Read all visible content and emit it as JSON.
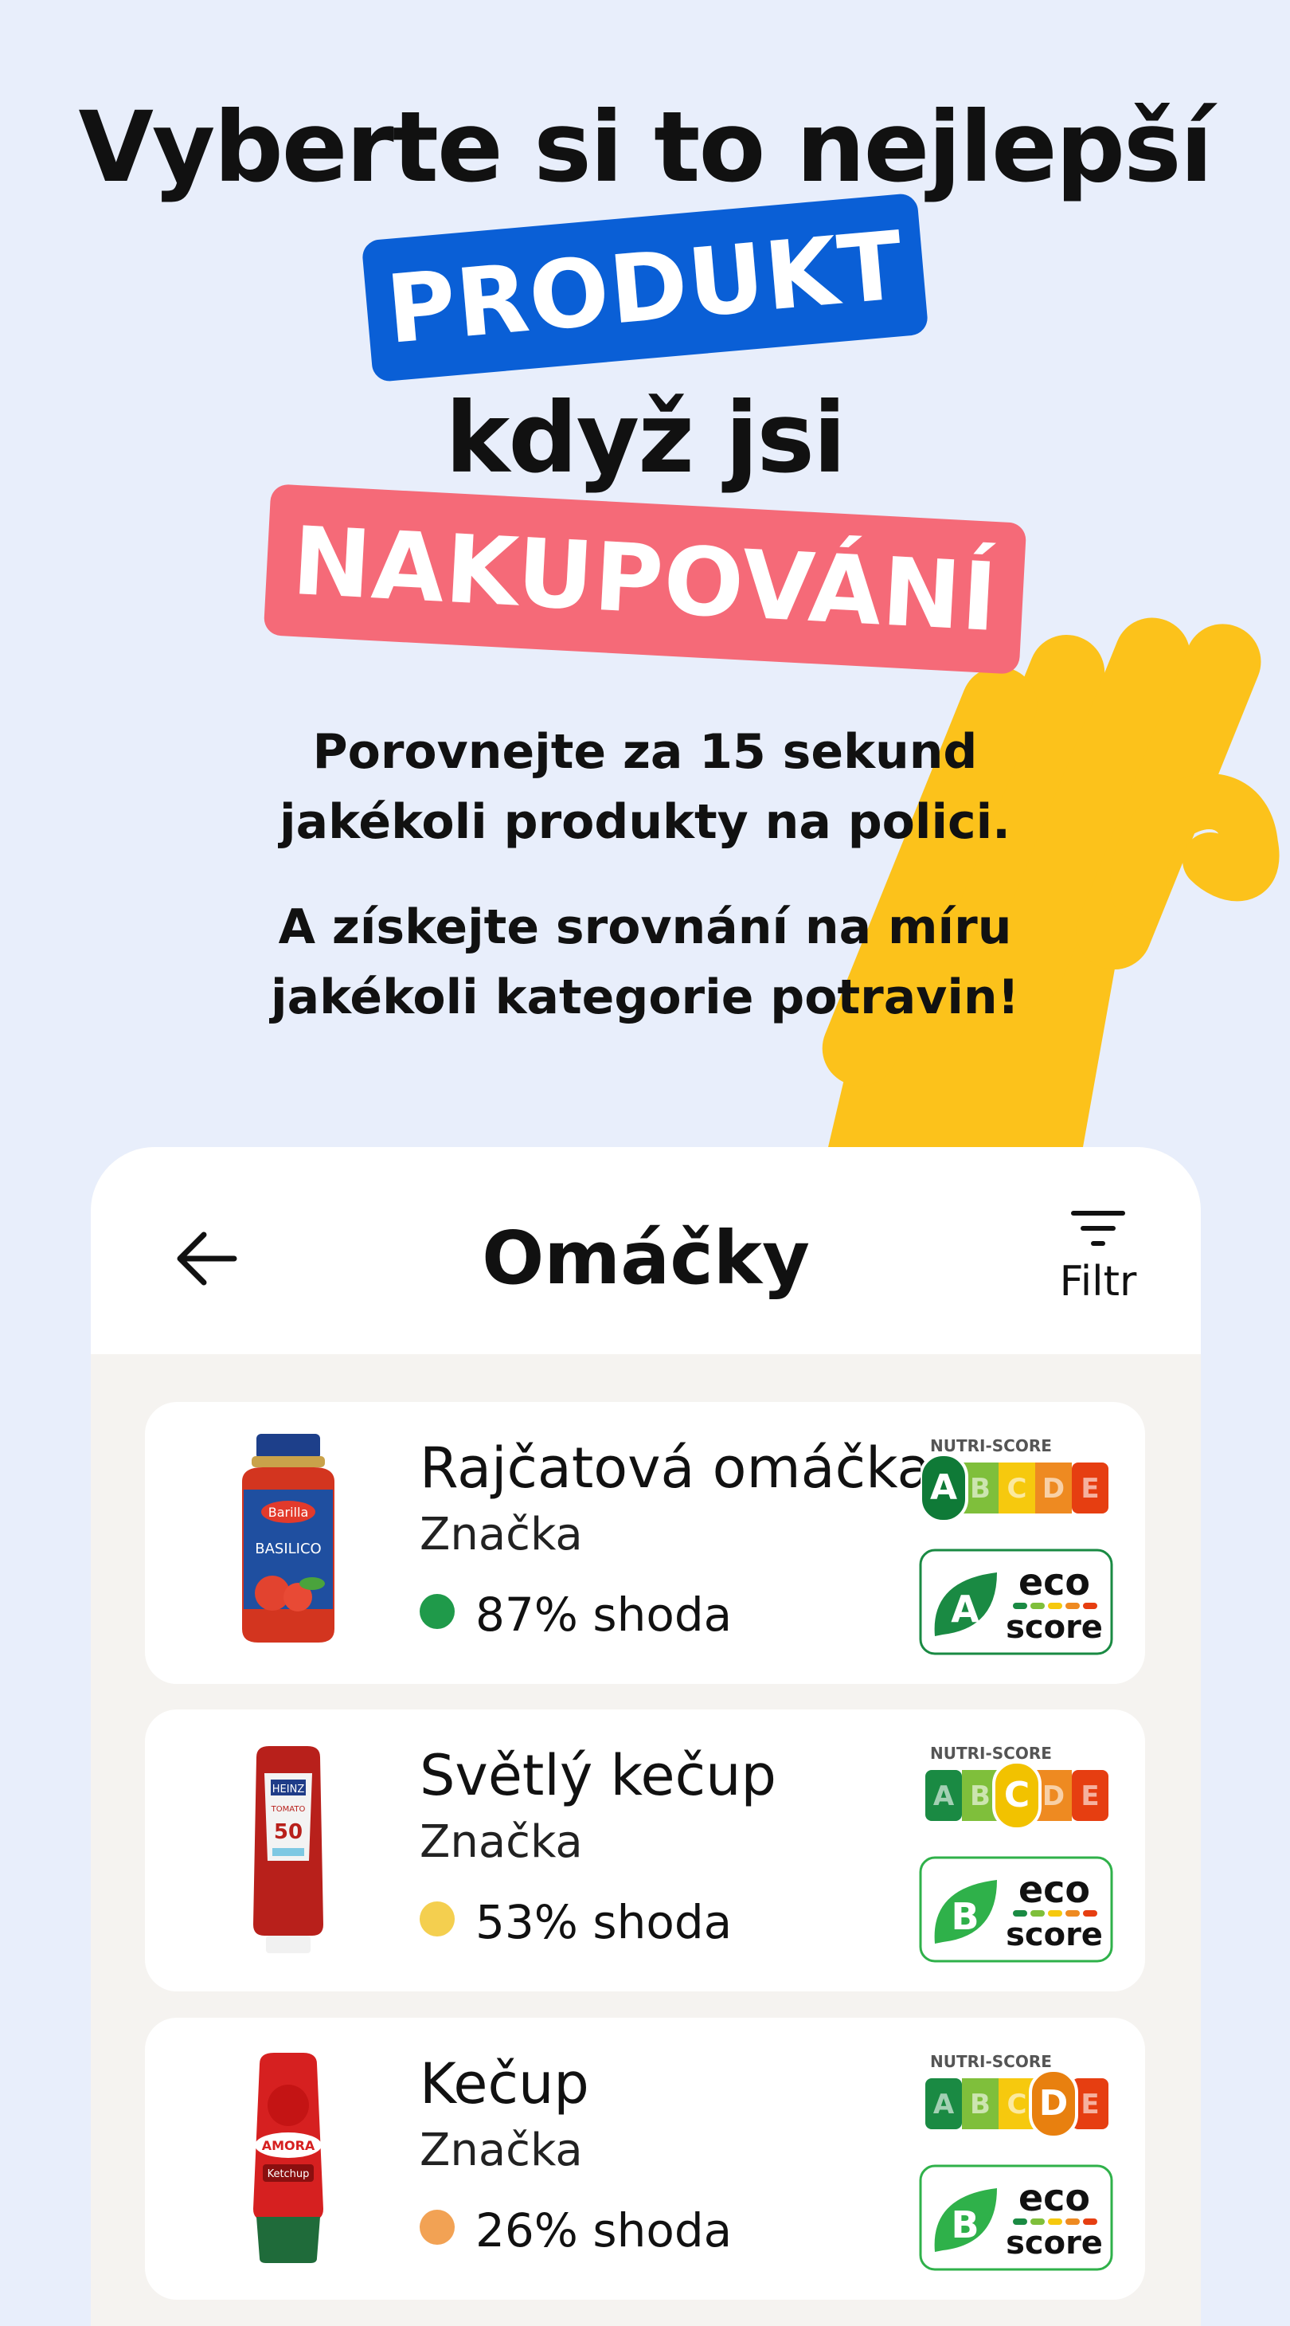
{
  "hero": {
    "line1": "Vyberte si to nejlepší",
    "badge1": "PRODUKT",
    "line3": "když jsi",
    "badge2": "NAKUPOVÁNÍ",
    "sub1_l1": "Porovnejte za 15 sekund",
    "sub1_l2": "jakékoli produkty na polici.",
    "sub2_l1": "A získejte srovnání na míru",
    "sub2_l2": "jakékoli kategorie potravin!"
  },
  "colors": {
    "background": "#e8eefb",
    "badge_blue": "#0a5fd6",
    "badge_pink": "#f56a78",
    "hand_yellow": "#fcc21b"
  },
  "screen": {
    "title": "Omáčky",
    "back_icon": "arrow-left-icon",
    "filter_label": "Filtr",
    "filter_icon": "filter-icon"
  },
  "products": [
    {
      "name": "Rajčatová omáčka",
      "brand": "Značka",
      "match": "87% shoda",
      "match_color": "#1f9a4a",
      "nutri_score": "A",
      "nutri_label": "NUTRI-SCORE",
      "eco_score": "A",
      "eco_word1": "eco",
      "eco_word2": "score",
      "jar_label": "BASILICO",
      "jar_brand": "Barilla"
    },
    {
      "name": "Světlý kečup",
      "brand": "Značka",
      "match": "53% shoda",
      "match_color": "#f4cf4f",
      "nutri_score": "C",
      "nutri_label": "NUTRI-SCORE",
      "eco_score": "B",
      "eco_word1": "eco",
      "eco_word2": "score",
      "bottle_brand": "HEINZ"
    },
    {
      "name": "Kečup",
      "brand": "Značka",
      "match": "26% shoda",
      "match_color": "#f2a254",
      "nutri_score": "D",
      "nutri_label": "NUTRI-SCORE",
      "eco_score": "B",
      "eco_word1": "eco",
      "eco_word2": "score",
      "bottle_brand": "AMORA",
      "bottle_label": "Ketchup"
    }
  ]
}
